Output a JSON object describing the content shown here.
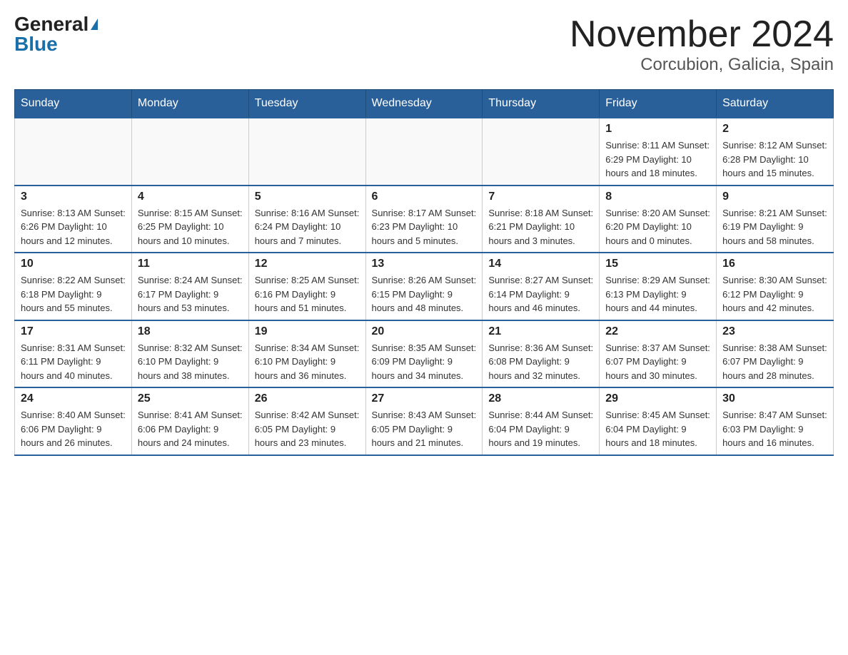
{
  "header": {
    "logo_general": "General",
    "logo_blue": "Blue",
    "title": "November 2024",
    "subtitle": "Corcubion, Galicia, Spain"
  },
  "weekdays": [
    "Sunday",
    "Monday",
    "Tuesday",
    "Wednesday",
    "Thursday",
    "Friday",
    "Saturday"
  ],
  "weeks": [
    [
      {
        "day": "",
        "info": ""
      },
      {
        "day": "",
        "info": ""
      },
      {
        "day": "",
        "info": ""
      },
      {
        "day": "",
        "info": ""
      },
      {
        "day": "",
        "info": ""
      },
      {
        "day": "1",
        "info": "Sunrise: 8:11 AM\nSunset: 6:29 PM\nDaylight: 10 hours and 18 minutes."
      },
      {
        "day": "2",
        "info": "Sunrise: 8:12 AM\nSunset: 6:28 PM\nDaylight: 10 hours and 15 minutes."
      }
    ],
    [
      {
        "day": "3",
        "info": "Sunrise: 8:13 AM\nSunset: 6:26 PM\nDaylight: 10 hours and 12 minutes."
      },
      {
        "day": "4",
        "info": "Sunrise: 8:15 AM\nSunset: 6:25 PM\nDaylight: 10 hours and 10 minutes."
      },
      {
        "day": "5",
        "info": "Sunrise: 8:16 AM\nSunset: 6:24 PM\nDaylight: 10 hours and 7 minutes."
      },
      {
        "day": "6",
        "info": "Sunrise: 8:17 AM\nSunset: 6:23 PM\nDaylight: 10 hours and 5 minutes."
      },
      {
        "day": "7",
        "info": "Sunrise: 8:18 AM\nSunset: 6:21 PM\nDaylight: 10 hours and 3 minutes."
      },
      {
        "day": "8",
        "info": "Sunrise: 8:20 AM\nSunset: 6:20 PM\nDaylight: 10 hours and 0 minutes."
      },
      {
        "day": "9",
        "info": "Sunrise: 8:21 AM\nSunset: 6:19 PM\nDaylight: 9 hours and 58 minutes."
      }
    ],
    [
      {
        "day": "10",
        "info": "Sunrise: 8:22 AM\nSunset: 6:18 PM\nDaylight: 9 hours and 55 minutes."
      },
      {
        "day": "11",
        "info": "Sunrise: 8:24 AM\nSunset: 6:17 PM\nDaylight: 9 hours and 53 minutes."
      },
      {
        "day": "12",
        "info": "Sunrise: 8:25 AM\nSunset: 6:16 PM\nDaylight: 9 hours and 51 minutes."
      },
      {
        "day": "13",
        "info": "Sunrise: 8:26 AM\nSunset: 6:15 PM\nDaylight: 9 hours and 48 minutes."
      },
      {
        "day": "14",
        "info": "Sunrise: 8:27 AM\nSunset: 6:14 PM\nDaylight: 9 hours and 46 minutes."
      },
      {
        "day": "15",
        "info": "Sunrise: 8:29 AM\nSunset: 6:13 PM\nDaylight: 9 hours and 44 minutes."
      },
      {
        "day": "16",
        "info": "Sunrise: 8:30 AM\nSunset: 6:12 PM\nDaylight: 9 hours and 42 minutes."
      }
    ],
    [
      {
        "day": "17",
        "info": "Sunrise: 8:31 AM\nSunset: 6:11 PM\nDaylight: 9 hours and 40 minutes."
      },
      {
        "day": "18",
        "info": "Sunrise: 8:32 AM\nSunset: 6:10 PM\nDaylight: 9 hours and 38 minutes."
      },
      {
        "day": "19",
        "info": "Sunrise: 8:34 AM\nSunset: 6:10 PM\nDaylight: 9 hours and 36 minutes."
      },
      {
        "day": "20",
        "info": "Sunrise: 8:35 AM\nSunset: 6:09 PM\nDaylight: 9 hours and 34 minutes."
      },
      {
        "day": "21",
        "info": "Sunrise: 8:36 AM\nSunset: 6:08 PM\nDaylight: 9 hours and 32 minutes."
      },
      {
        "day": "22",
        "info": "Sunrise: 8:37 AM\nSunset: 6:07 PM\nDaylight: 9 hours and 30 minutes."
      },
      {
        "day": "23",
        "info": "Sunrise: 8:38 AM\nSunset: 6:07 PM\nDaylight: 9 hours and 28 minutes."
      }
    ],
    [
      {
        "day": "24",
        "info": "Sunrise: 8:40 AM\nSunset: 6:06 PM\nDaylight: 9 hours and 26 minutes."
      },
      {
        "day": "25",
        "info": "Sunrise: 8:41 AM\nSunset: 6:06 PM\nDaylight: 9 hours and 24 minutes."
      },
      {
        "day": "26",
        "info": "Sunrise: 8:42 AM\nSunset: 6:05 PM\nDaylight: 9 hours and 23 minutes."
      },
      {
        "day": "27",
        "info": "Sunrise: 8:43 AM\nSunset: 6:05 PM\nDaylight: 9 hours and 21 minutes."
      },
      {
        "day": "28",
        "info": "Sunrise: 8:44 AM\nSunset: 6:04 PM\nDaylight: 9 hours and 19 minutes."
      },
      {
        "day": "29",
        "info": "Sunrise: 8:45 AM\nSunset: 6:04 PM\nDaylight: 9 hours and 18 minutes."
      },
      {
        "day": "30",
        "info": "Sunrise: 8:47 AM\nSunset: 6:03 PM\nDaylight: 9 hours and 16 minutes."
      }
    ]
  ]
}
